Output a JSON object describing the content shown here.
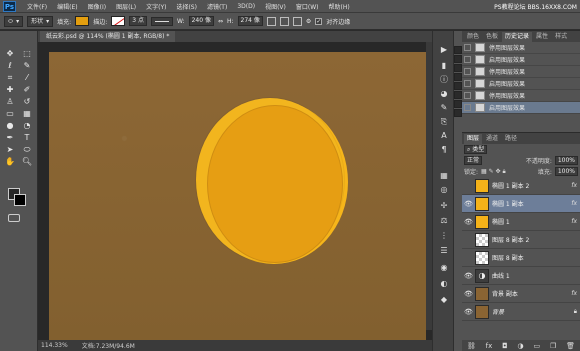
{
  "app": {
    "logo": "Ps"
  },
  "menubar": {
    "items": [
      "文件(F)",
      "编辑(E)",
      "图像(I)",
      "图层(L)",
      "文字(Y)",
      "选择(S)",
      "滤镜(T)",
      "3D(D)",
      "视图(V)",
      "窗口(W)",
      "帮助(H)"
    ],
    "watermark": "PS教程论坛 BBS.16XX8.COM"
  },
  "options_bar": {
    "shape_mode": "形状",
    "fill_label": "填充:",
    "stroke_label": "描边:",
    "stroke_size": "3 点",
    "width_label": "W:",
    "width_value": "240 像",
    "height_label": "H:",
    "height_value": "274 像",
    "align_edges_label": "对齐边缘",
    "fill_color": "#e39e0f"
  },
  "document": {
    "tab_title": "纸云彩.psd @ 114% (椭圆 1 副本, RGB/8) *",
    "canvas_color": "#8a6433",
    "coin_color": "#e69e13",
    "coin_highlight_color": "#f6b51a"
  },
  "status": {
    "zoom": "114.33%",
    "doc_info": "文档:7.23M/94.6M"
  },
  "history_panel": {
    "tabs": [
      "颜色",
      "色板",
      "历史记录",
      "属性",
      "样式"
    ],
    "active_tab": "历史记录",
    "items": [
      {
        "label": "停用图层效果",
        "selected": false
      },
      {
        "label": "启用图层效果",
        "selected": false
      },
      {
        "label": "停用图层效果",
        "selected": false
      },
      {
        "label": "启用图层效果",
        "selected": false
      },
      {
        "label": "停用图层效果",
        "selected": false
      },
      {
        "label": "启用图层效果",
        "selected": true
      }
    ],
    "side_button": "基本功能"
  },
  "layers_panel": {
    "tabs": [
      "图层",
      "通道",
      "路径"
    ],
    "active_tab": "图层",
    "kind_filter": "类型",
    "blend_mode": "正常",
    "opacity_label": "不透明度:",
    "opacity_value": "100%",
    "lock_label": "锁定:",
    "fill_label": "填充:",
    "fill_value": "100%",
    "layers": [
      {
        "name": "椭圆 1 副本 2",
        "thumb": "orange",
        "visible": false,
        "fx": "fx",
        "selected": false
      },
      {
        "name": "椭圆 1 副本",
        "thumb": "orange",
        "visible": true,
        "fx": "fx",
        "selected": true
      },
      {
        "name": "椭圆 1",
        "thumb": "orange",
        "visible": true,
        "fx": "fx",
        "selected": false
      },
      {
        "name": "图层 8 副本 2",
        "thumb": "checker",
        "visible": false,
        "fx": "",
        "selected": false
      },
      {
        "name": "图层 8 副本",
        "thumb": "checker",
        "visible": false,
        "fx": "",
        "selected": false
      },
      {
        "name": "曲线 1",
        "thumb": "adjust",
        "visible": true,
        "fx": "",
        "selected": false
      },
      {
        "name": "背景 副本",
        "thumb": "brown",
        "visible": true,
        "fx": "fx",
        "selected": false
      },
      {
        "name": "背景",
        "thumb": "brown",
        "visible": true,
        "fx": "",
        "selected": false,
        "locked": true
      }
    ],
    "footer_icons": [
      "link-icon",
      "fx-icon",
      "mask-icon",
      "adjustment-icon",
      "folder-icon",
      "new-layer-icon",
      "trash-icon"
    ]
  }
}
